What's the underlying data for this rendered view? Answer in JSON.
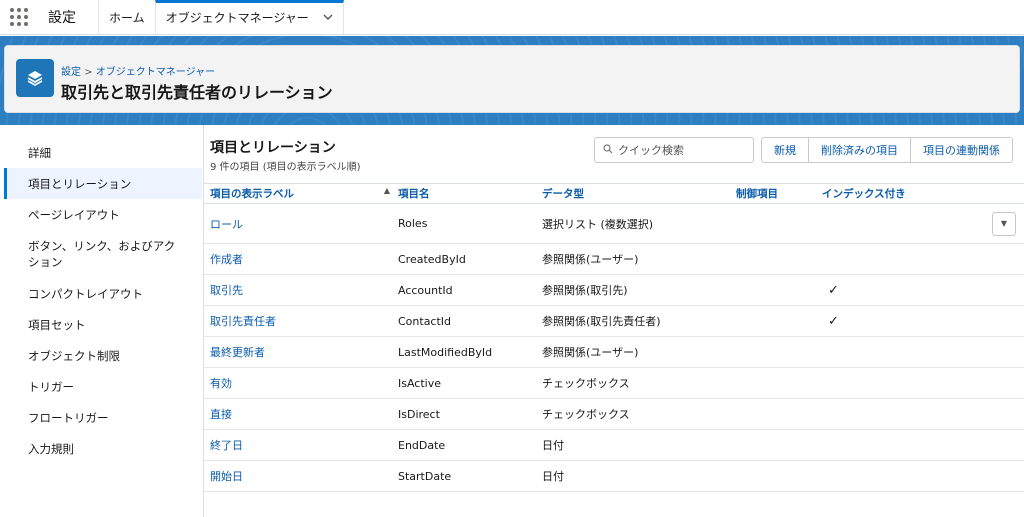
{
  "nav": {
    "app_name": "設定",
    "tabs": [
      {
        "label": "ホーム"
      },
      {
        "label": "オブジェクトマネージャー"
      }
    ]
  },
  "header": {
    "breadcrumb": {
      "part1": "設定",
      "sep": ">",
      "part2": "オブジェクトマネージャー"
    },
    "title": "取引先と取引先責任者のリレーション"
  },
  "sidebar": {
    "items": [
      {
        "label": "詳細"
      },
      {
        "label": "項目とリレーション"
      },
      {
        "label": "ページレイアウト"
      },
      {
        "label": "ボタン、リンク、およびアクション"
      },
      {
        "label": "コンパクトレイアウト"
      },
      {
        "label": "項目セット"
      },
      {
        "label": "オブジェクト制限"
      },
      {
        "label": "トリガー"
      },
      {
        "label": "フロートリガー"
      },
      {
        "label": "入力規則"
      }
    ]
  },
  "main": {
    "title": "項目とリレーション",
    "subtitle": "9 件の項目 (項目の表示ラベル順)",
    "search_placeholder": "クイック検索",
    "buttons": {
      "new": "新規",
      "deleted": "削除済みの項目",
      "dependencies": "項目の連動関係"
    },
    "columns": [
      "項目の表示ラベル",
      "項目名",
      "データ型",
      "制御項目",
      "インデックス付き"
    ],
    "rows": [
      {
        "label": "ロール",
        "api": "Roles",
        "type": "選択リスト (複数選択)",
        "controlling": "",
        "indexed": ""
      },
      {
        "label": "作成者",
        "api": "CreatedById",
        "type": "参照関係(ユーザー)",
        "controlling": "",
        "indexed": ""
      },
      {
        "label": "取引先",
        "api": "AccountId",
        "type": "参照関係(取引先)",
        "controlling": "",
        "indexed": "✓"
      },
      {
        "label": "取引先責任者",
        "api": "ContactId",
        "type": "参照関係(取引先責任者)",
        "controlling": "",
        "indexed": "✓"
      },
      {
        "label": "最終更新者",
        "api": "LastModifiedById",
        "type": "参照関係(ユーザー)",
        "controlling": "",
        "indexed": ""
      },
      {
        "label": "有効",
        "api": "IsActive",
        "type": "チェックボックス",
        "controlling": "",
        "indexed": ""
      },
      {
        "label": "直接",
        "api": "IsDirect",
        "type": "チェックボックス",
        "controlling": "",
        "indexed": ""
      },
      {
        "label": "終了日",
        "api": "EndDate",
        "type": "日付",
        "controlling": "",
        "indexed": ""
      },
      {
        "label": "開始日",
        "api": "StartDate",
        "type": "日付",
        "controlling": "",
        "indexed": ""
      }
    ]
  }
}
